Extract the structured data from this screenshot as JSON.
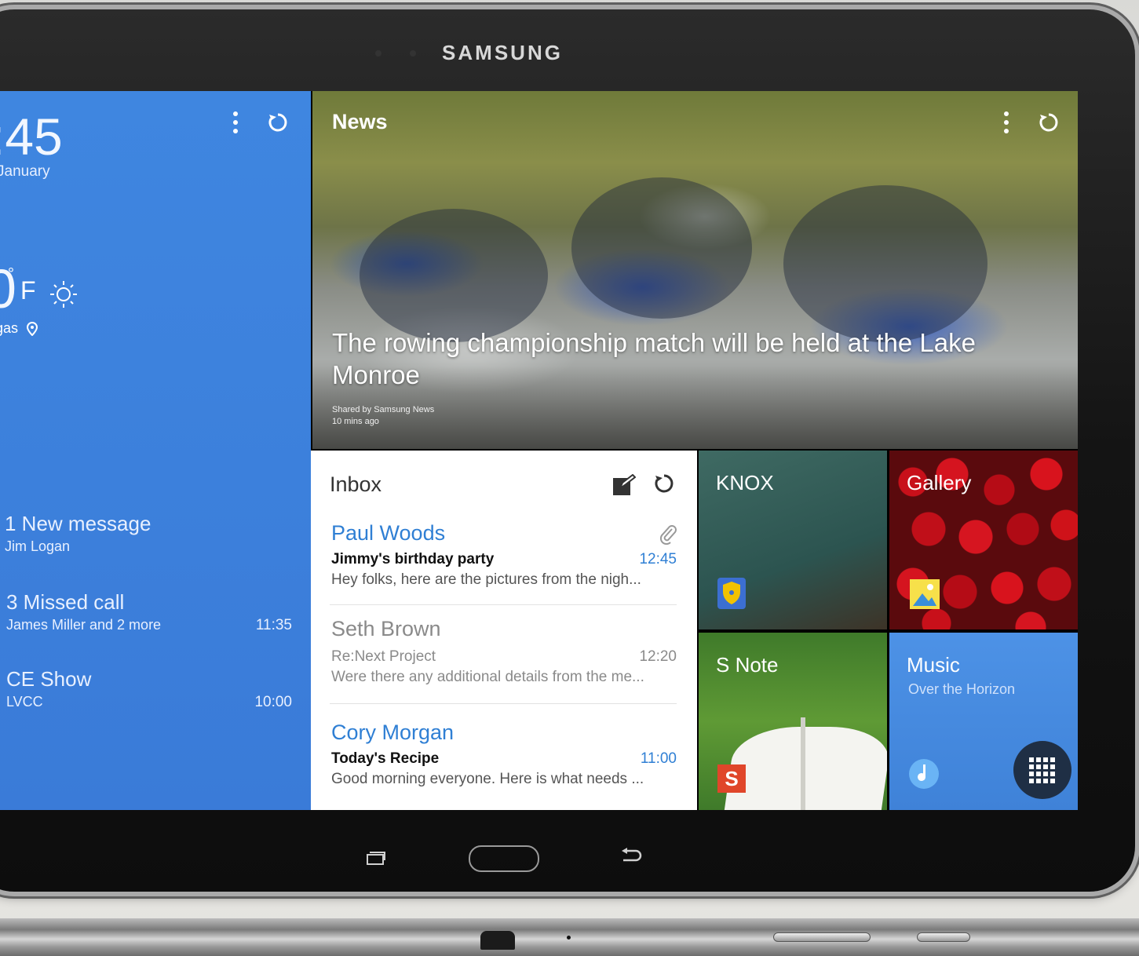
{
  "device": {
    "brand": "SAMSUNG"
  },
  "left_panel": {
    "clock": ":45",
    "date": "January",
    "temperature": "0",
    "temperature_unit": "F",
    "city": "gas",
    "notifications": [
      {
        "title": "1 New message",
        "subtitle": "Jim Logan",
        "time": ""
      },
      {
        "title": "3 Missed call",
        "subtitle": "James Miller and 2 more",
        "time": "11:35"
      },
      {
        "title": "CE Show",
        "subtitle": "LVCC",
        "time": "10:00"
      }
    ]
  },
  "news": {
    "title": "News",
    "headline": "The rowing championship match will be held at the Lake Monroe",
    "source": "Shared by Samsung News",
    "age": "10 mins ago"
  },
  "inbox": {
    "title": "Inbox",
    "messages": [
      {
        "sender": "Paul Woods",
        "subject": "Jimmy's birthday party",
        "time": "12:45",
        "preview": "Hey folks, here are the pictures from the nigh...",
        "unread": true
      },
      {
        "sender": "Seth Brown",
        "subject": "Re:Next Project",
        "time": "12:20",
        "preview": "Were there any additional details from the me...",
        "unread": false
      },
      {
        "sender": "Cory Morgan",
        "subject": "Today's Recipe",
        "time": "11:00",
        "preview": "Good morning everyone. Here is what needs ...",
        "unread": true
      }
    ]
  },
  "tiles": {
    "knox": {
      "label": "KNOX"
    },
    "gallery": {
      "label": "Gallery"
    },
    "snote": {
      "label": "S Note",
      "badge": "S"
    },
    "music": {
      "label": "Music",
      "subtitle": "Over the Horizon"
    }
  },
  "colors": {
    "accent_blue": "#3d7fda",
    "unread_sender": "#2f7fd4",
    "read_sender": "#8a8a8a"
  }
}
